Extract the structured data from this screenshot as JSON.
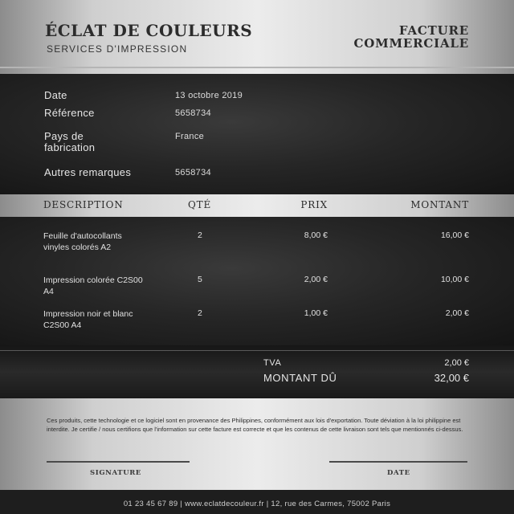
{
  "header": {
    "company_name": "ÉCLAT DE COULEURS",
    "company_subtitle": "SERVICES D'IMPRESSION",
    "doc_title": "FACTURE COMMERCIALE"
  },
  "info": [
    {
      "label": "Date",
      "value": "13 octobre 2019"
    },
    {
      "label": "Référence",
      "value": "5658734"
    },
    {
      "label": "Pays de fabrication",
      "value": "France"
    },
    {
      "label": "Autres remarques",
      "value": "5658734"
    }
  ],
  "table": {
    "headers": {
      "description": "DESCRIPTION",
      "qty": "QTÉ",
      "price": "PRIX",
      "amount": "MONTANT"
    },
    "rows": [
      {
        "description": "Feuille d'autocollants vinyles colorés A2",
        "qty": "2",
        "price": "8,00 €",
        "amount": "16,00 €"
      },
      {
        "description": "Impression colorée C2S00 A4",
        "qty": "5",
        "price": "2,00 €",
        "amount": "10,00 €"
      },
      {
        "description": "Impression noir et blanc C2S00 A4",
        "qty": "2",
        "price": "1,00 €",
        "amount": "2,00 €"
      }
    ]
  },
  "totals": {
    "tax_label": "TVA",
    "tax_value": "2,00 €",
    "total_label": "MONTANT DÛ",
    "total_value": "32,00 €"
  },
  "legal_text": "Ces produits, cette technologie et ce logiciel sont en provenance des Philippines, conformément aux lois d'exportation. Toute déviation à la loi philippine est interdite. Je certifie / nous certifions que l'information sur cette facture est correcte et que les contenus de cette livraison sont tels que mentionnés ci-dessus.",
  "signature": {
    "signature_label": "SIGNATURE",
    "date_label": "DATE"
  },
  "footer": "01 23 45 67 89 | www.eclatdecouleur.fr | 12, rue des Carmes, 75002 Paris"
}
